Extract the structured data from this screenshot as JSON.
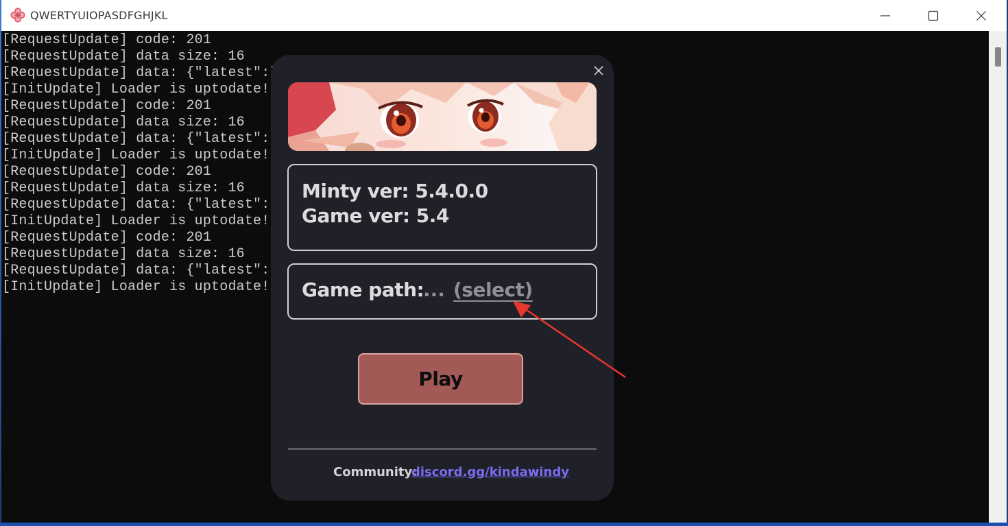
{
  "window": {
    "title": "QWERTYUIOPASDFGHJKL",
    "icon": "pink-flower-icon",
    "controls": [
      "minimize-icon",
      "maximize-icon",
      "close-icon"
    ]
  },
  "console": {
    "lines": [
      "[RequestUpdate] code: 201",
      "[RequestUpdate] data size: 16",
      "[RequestUpdate] data: {\"latest\":\"",
      "[InitUpdate] Loader is uptodate!",
      "[RequestUpdate] code: 201",
      "[RequestUpdate] data size: 16",
      "[RequestUpdate] data: {\"latest\":\"",
      "[InitUpdate] Loader is uptodate!",
      "[RequestUpdate] code: 201",
      "[RequestUpdate] data size: 16",
      "[RequestUpdate] data: {\"latest\":\"",
      "[InitUpdate] Loader is uptodate!",
      "[RequestUpdate] code: 201",
      "[RequestUpdate] data size: 16",
      "[RequestUpdate] data: {\"latest\":\"",
      "[InitUpdate] Loader is uptodate!"
    ]
  },
  "dialog": {
    "minty_version": "Minty ver: 5.4.0.0",
    "game_version": "Game ver: 5.4",
    "game_path_label": "Game path:",
    "game_path_value": "...",
    "select_link": "(select)",
    "play_button": "Play",
    "community_label": "Community:",
    "community_link": "discord.gg/kindawindy"
  },
  "colors": {
    "dialog_bg": "#202028",
    "play_button": "#a35a57",
    "link": "#7b6cf0",
    "annotation_arrow": "#e8372e"
  }
}
